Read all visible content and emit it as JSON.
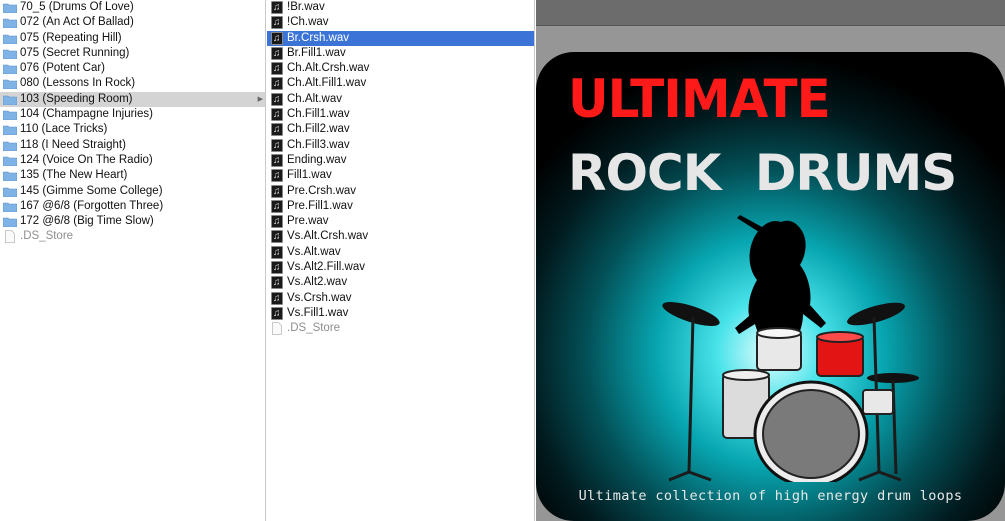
{
  "left_column": {
    "items": [
      {
        "name": "70_5 (Drums Of Love)"
      },
      {
        "name": "072 (An Act Of Ballad)"
      },
      {
        "name": "075 (Repeating Hill)"
      },
      {
        "name": "075 (Secret Running)"
      },
      {
        "name": "076 (Potent Car)"
      },
      {
        "name": "080 (Lessons In Rock)"
      },
      {
        "name": "103 (Speeding Room)"
      },
      {
        "name": "104 (Champagne Injuries)"
      },
      {
        "name": "110 (Lace Tricks)"
      },
      {
        "name": "118 (I Need Straight)"
      },
      {
        "name": "124 (Voice On The Radio)"
      },
      {
        "name": "135 (The New Heart)"
      },
      {
        "name": "145 (Gimme Some College)"
      },
      {
        "name": "167 @6/8 (Forgotten Three)"
      },
      {
        "name": "172 @6/8 (Big Time Slow)"
      },
      {
        "name": ".DS_Store"
      }
    ]
  },
  "middle_column": {
    "items": [
      {
        "name": "!Br.wav"
      },
      {
        "name": "!Ch.wav"
      },
      {
        "name": "Br.Crsh.wav"
      },
      {
        "name": "Br.Fill1.wav"
      },
      {
        "name": "Ch.Alt.Crsh.wav"
      },
      {
        "name": "Ch.Alt.Fill1.wav"
      },
      {
        "name": "Ch.Alt.wav"
      },
      {
        "name": "Ch.Fill1.wav"
      },
      {
        "name": "Ch.Fill2.wav"
      },
      {
        "name": "Ch.Fill3.wav"
      },
      {
        "name": "Ending.wav"
      },
      {
        "name": "Fill1.wav"
      },
      {
        "name": "Pre.Crsh.wav"
      },
      {
        "name": "Pre.Fill1.wav"
      },
      {
        "name": "Pre.wav"
      },
      {
        "name": "Vs.Alt.Crsh.wav"
      },
      {
        "name": "Vs.Alt.wav"
      },
      {
        "name": "Vs.Alt2.Fill.wav"
      },
      {
        "name": "Vs.Alt2.wav"
      },
      {
        "name": "Vs.Crsh.wav"
      },
      {
        "name": "Vs.Fill1.wav"
      },
      {
        "name": ".DS_Store"
      }
    ]
  },
  "preview": {
    "title_line1": "ULTIMATE",
    "title_line2": "ROCK DRUMS",
    "subtitle": "Ultimate collection of high energy drum loops"
  },
  "colors": {
    "selection_blue": "#3b74d6",
    "selection_gray": "#d4d4d4",
    "title_red": "#ff1a1a",
    "folder_blue": "#7fb3e6"
  }
}
